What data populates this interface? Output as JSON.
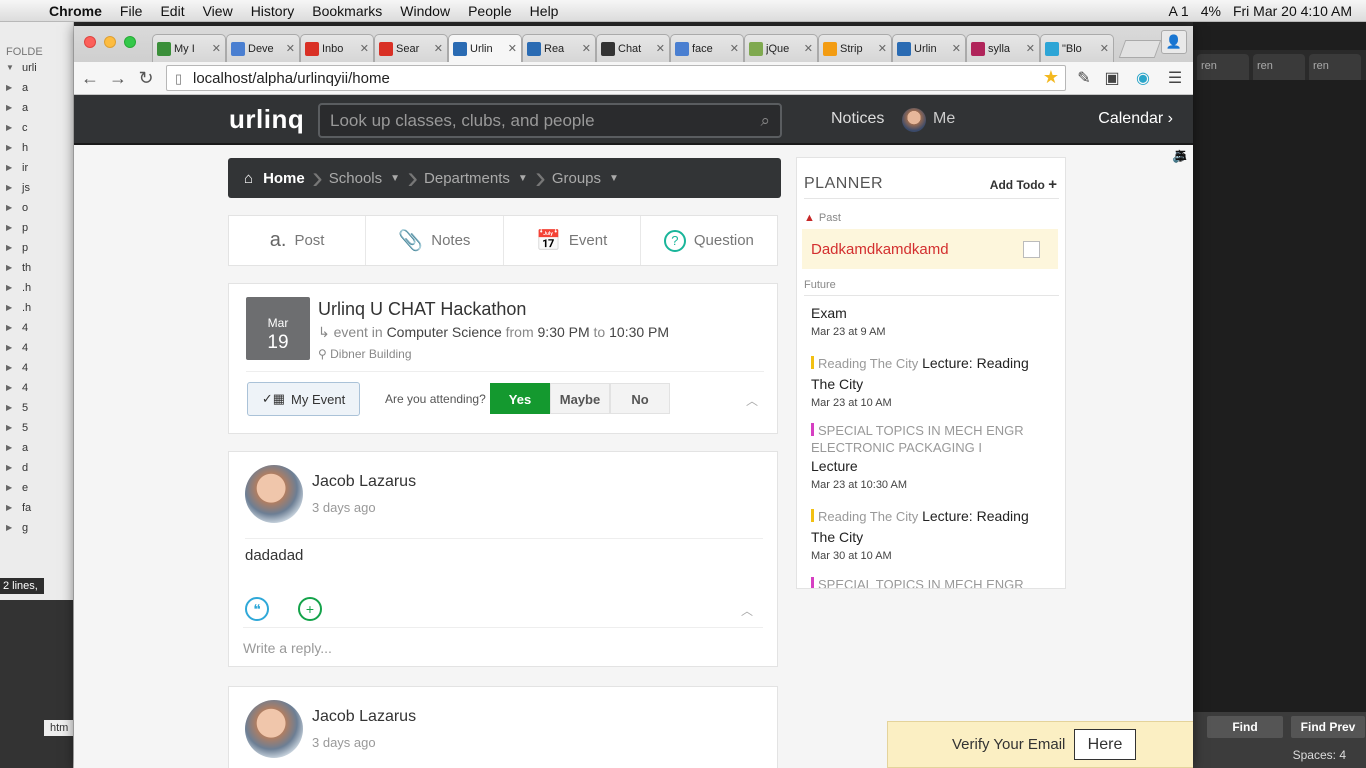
{
  "menubar": {
    "apple": "",
    "items": [
      "Chrome",
      "File",
      "Edit",
      "View",
      "History",
      "Bookmarks",
      "Window",
      "People",
      "Help"
    ],
    "status": {
      "adobe": "A 1",
      "battery": "4%",
      "clock": "Fri Mar 20  4:10 AM"
    }
  },
  "editor": {
    "folder_header": "FOLDE",
    "tree": [
      "urli",
      "a",
      "a",
      "c",
      "h",
      "ir",
      "js",
      "o",
      "p",
      "p",
      "th",
      ".h",
      ".h",
      "4",
      "4",
      "4",
      "4",
      "5",
      "5",
      "a",
      "d",
      "e",
      "fa",
      "g"
    ],
    "lines_tip": "2 lines,",
    "html_tab": "htm",
    "right_tabs": [
      "ren",
      "ren",
      "ren"
    ],
    "find": "Find",
    "find_prev": "Find Prev",
    "spaces": "Spaces: 4"
  },
  "browser": {
    "tabs": [
      {
        "title": "My I",
        "color": "#3b8f3a"
      },
      {
        "title": "Deve",
        "color": "#4a7fd1"
      },
      {
        "title": "Inbo",
        "color": "#d93025"
      },
      {
        "title": "Sear",
        "color": "#d93025"
      },
      {
        "title": "Urlin",
        "color": "#2a6bb3",
        "active": true
      },
      {
        "title": "Rea",
        "color": "#2a6bb3"
      },
      {
        "title": "Chat",
        "color": "#333333"
      },
      {
        "title": "face",
        "color": "#4a7fd1"
      },
      {
        "title": "jQue",
        "color": "#7fa94f"
      },
      {
        "title": "Strip",
        "color": "#f39c12"
      },
      {
        "title": "Urlin",
        "color": "#2a6bb3"
      },
      {
        "title": "sylla",
        "color": "#b0245a"
      },
      {
        "title": "\"Blo",
        "color": "#2da5d6"
      }
    ],
    "url": "localhost/alpha/urlinqyii/home"
  },
  "site": {
    "logo": "urlinq",
    "search_placeholder": "Look up classes, clubs, and people",
    "notices": "Notices",
    "me": "Me",
    "calendar": "Calendar"
  },
  "breadcrumbs": [
    {
      "label": "Home"
    },
    {
      "label": "Schools"
    },
    {
      "label": "Departments"
    },
    {
      "label": "Groups"
    }
  ],
  "composer": [
    {
      "label": "Post",
      "icon": "a."
    },
    {
      "label": "Notes",
      "icon": "📎"
    },
    {
      "label": "Event",
      "icon": "📅"
    },
    {
      "label": "Question",
      "icon": "?"
    }
  ],
  "event": {
    "month": "Mar",
    "day": "19",
    "title": "Urlinq U CHAT Hackathon",
    "prefix": "event in",
    "course": "Computer Science",
    "from_label": "from",
    "start": "9:30 PM",
    "to_label": "to",
    "end": "10:30 PM",
    "location": "Dibner Building",
    "my_event": "My Event",
    "attending_q": "Are you attending?",
    "rsvp": [
      "Yes",
      "Maybe",
      "No"
    ]
  },
  "posts": [
    {
      "author": "Jacob Lazarus",
      "time": "3 days ago",
      "body": "dadadad",
      "reply_placeholder": "Write a reply..."
    },
    {
      "author": "Jacob Lazarus",
      "time": "3 days ago"
    }
  ],
  "planner": {
    "title": "PLANNER",
    "add_todo": "Add Todo",
    "past_label": "Past",
    "past_item": "Dadkamdkamdkamd",
    "future_label": "Future",
    "items": [
      {
        "prefix": "",
        "title": "Exam",
        "when": "Mar 23 at 9 AM",
        "bar": ""
      },
      {
        "prefix": "Reading The City",
        "title": "Lecture: Reading The City",
        "when": "Mar 23 at 10 AM",
        "bar": "#f2c012"
      },
      {
        "prefix": "SPECIAL TOPICS IN MECH ENGR ELECTRONIC PACKAGING I",
        "title": "Lecture",
        "when": "Mar 23 at 10:30 AM",
        "bar": "#d63fc2"
      },
      {
        "prefix": "Reading The City",
        "title": "Lecture: Reading The City",
        "when": "Mar 30 at 10 AM",
        "bar": "#f2c012"
      },
      {
        "prefix": "SPECIAL TOPICS IN MECH ENGR",
        "title": "",
        "when": "",
        "bar": "#d63fc2"
      }
    ]
  },
  "verify": {
    "text": "Verify Your Email",
    "button": "Here"
  }
}
